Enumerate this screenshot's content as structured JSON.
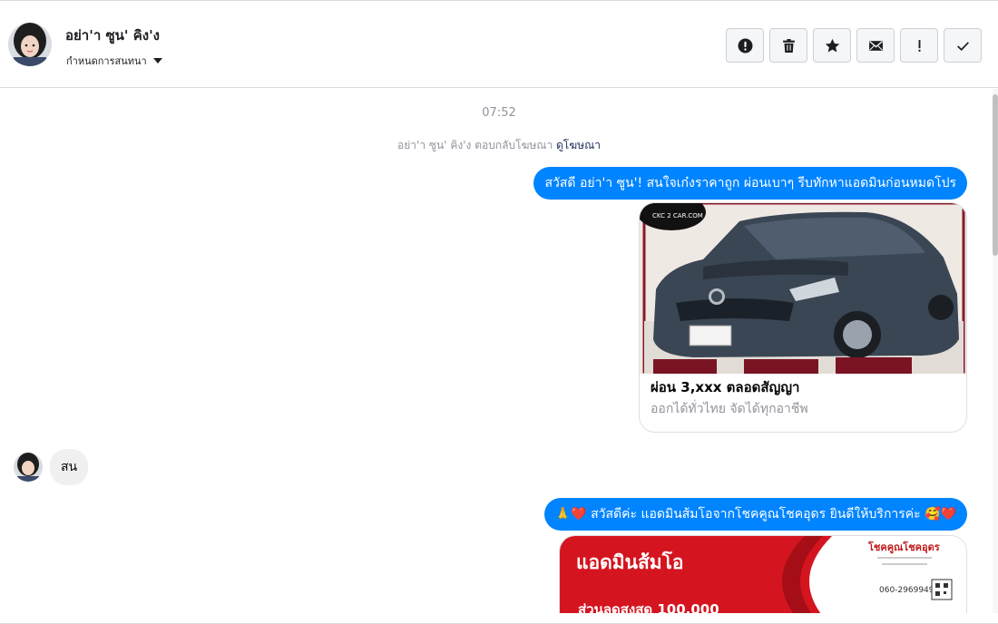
{
  "header": {
    "contact_name": "อย่า'า ซูน' คิง'ง",
    "assign_label": "กำหนดการสนทนา",
    "toolbar": [
      {
        "name": "spam-button",
        "icon": "alert-circle-icon",
        "tooltip": ""
      },
      {
        "name": "delete-button",
        "icon": "trash-icon",
        "tooltip": ""
      },
      {
        "name": "star-button",
        "icon": "star-icon",
        "tooltip": ""
      },
      {
        "name": "mark-unread-button",
        "icon": "envelope-icon",
        "tooltip": ""
      },
      {
        "name": "follow-up-button",
        "icon": "exclamation-icon",
        "tooltip": ""
      },
      {
        "name": "mark-done-button",
        "icon": "check-icon",
        "tooltip": ""
      }
    ]
  },
  "conversation": {
    "timestamp": "07:52",
    "ad_notice": {
      "text": "อย่า'า ซูน' คิง'ง ตอบกลับโฆษณา",
      "link": "ดูโฆษณา"
    },
    "messages": [
      {
        "direction": "out",
        "text": "สวัสดี อย่า'า ซูน'! สนใจเก๋งราคาถูก ผ่อนเบาๆ รีบทักหาแอดมินก่อนหมดโปร"
      },
      {
        "direction": "out",
        "type": "card",
        "image_label": "CKC 2 CAR.COM",
        "title": "ผ่อน 3,xxx ตลอดสัญญา",
        "subtitle": "ออกได้ทั่วไทย จัดได้ทุกอาชีพ"
      },
      {
        "direction": "in",
        "text": "สน"
      },
      {
        "direction": "out",
        "text": "🙏❤️ สวัสดีค่ะ แอดมินส้มโอจากโชคคูณโชคอุดร ยินดีให้บริการค่ะ 🥰❤️"
      },
      {
        "direction": "out",
        "type": "image",
        "banner_title": "แอดมินส้มโอ",
        "banner_brand": "โชคคูณโชคอุดร",
        "banner_phone": "060-2969949",
        "banner_offer": "ส่วนลดสูงสุด 100,000"
      }
    ]
  },
  "colors": {
    "outgoing_bubble": "#0084ff",
    "incoming_bubble": "#f1f0f0",
    "link": "#1c2b58",
    "muted": "#90949c"
  }
}
